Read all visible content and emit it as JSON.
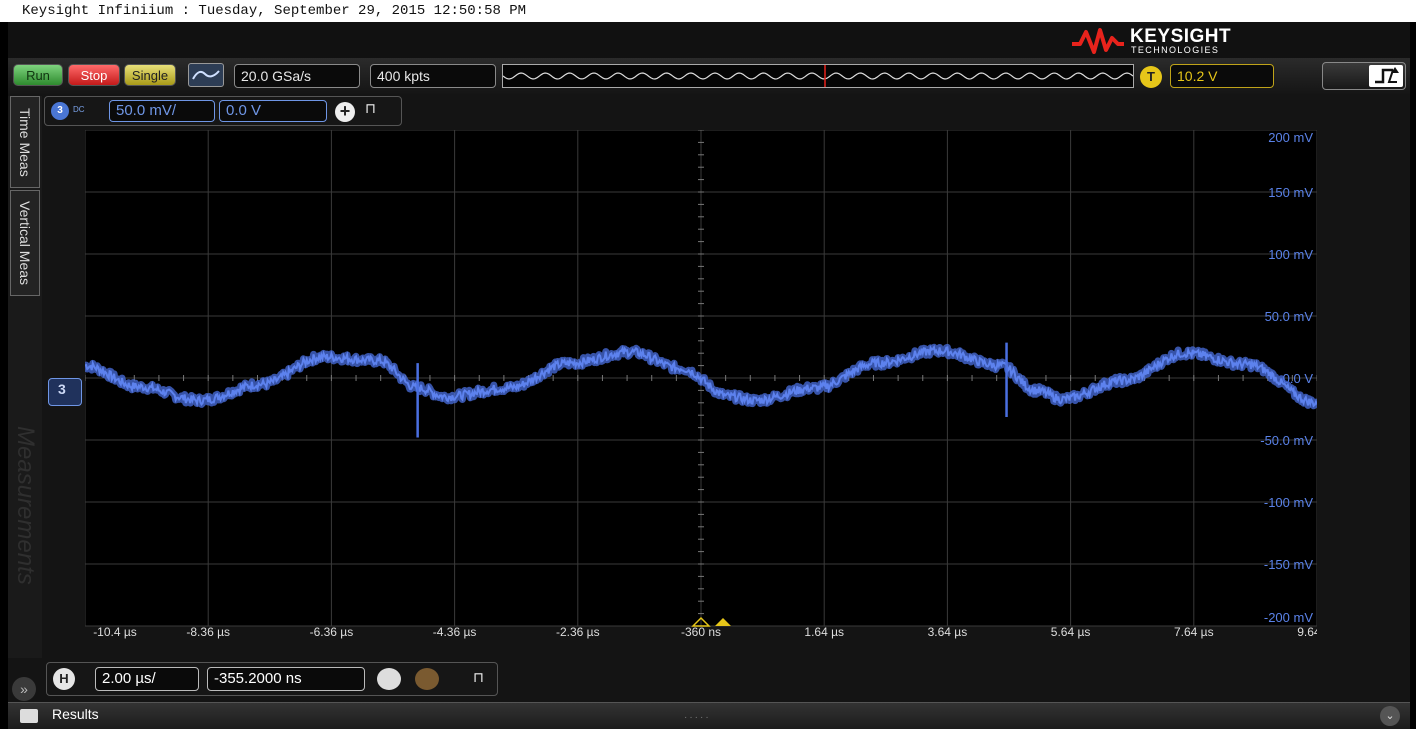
{
  "window": {
    "title": "Keysight Infiniium : Tuesday, September 29, 2015 12:50:58 PM"
  },
  "brand": {
    "name": "KEYSIGHT",
    "subtitle": "TECHNOLOGIES"
  },
  "toolbar": {
    "run_label": "Run",
    "stop_label": "Stop",
    "single_label": "Single",
    "sample_rate": "20.0 GSa/s",
    "memory_depth": "400 kpts",
    "trigger_badge": "T",
    "trigger_level": "10.2 V"
  },
  "channel": {
    "number": "3",
    "coupling": "DC",
    "scale": "50.0 mV/",
    "offset": "0.0 V"
  },
  "sidebar": {
    "tabs": [
      "Time Meas",
      "Vertical Meas"
    ],
    "watermark": "Measurements"
  },
  "horizontal": {
    "badge": "H",
    "scale": "2.00 µs/",
    "position": "-355.2000 ns"
  },
  "results": {
    "label": "Results"
  },
  "colors": {
    "trace": "#4a6fe0",
    "trigger": "#e6c619",
    "grid": "#3a3a3a"
  },
  "chart_data": {
    "type": "line",
    "x_tick_labels": [
      "-10.4 µs",
      "-8.36 µs",
      "-6.36 µs",
      "-4.36 µs",
      "-2.36 µs",
      "-360 ns",
      "1.64 µs",
      "3.64 µs",
      "5.64 µs",
      "7.64 µs",
      "9.64 µs"
    ],
    "y_tick_labels": [
      "200 mV",
      "150 mV",
      "100 mV",
      "50.0 mV",
      "0.0 V",
      "-50.0 mV",
      "-100 mV",
      "-150 mV",
      "-200 mV"
    ],
    "x_unit": "µs",
    "xlim": [
      -10.36,
      9.64
    ],
    "y_unit": "mV",
    "ylim": [
      -200,
      200
    ],
    "grid": true,
    "series": [
      {
        "x": [
          -10.36,
          -9.5,
          -8.5,
          -7.5,
          -6.5,
          -5.6,
          -4.96,
          -4.5,
          -3.5,
          -2.5,
          -1.5,
          -0.7,
          0.12,
          0.5,
          1.5,
          2.5,
          3.5,
          4.5,
          5.08,
          5.5,
          6.5,
          7.5,
          8.5,
          9.64
        ],
        "y": [
          10,
          -7,
          -18,
          -5,
          17,
          14,
          -8,
          -15,
          -8,
          12,
          21,
          8,
          -15,
          -18,
          -8,
          12,
          22,
          10,
          -10,
          -17,
          -2,
          20,
          11,
          -20
        ]
      }
    ],
    "spikes_x": [
      -4.96,
      4.6
    ],
    "spike_amplitude": [
      25,
      -40
    ],
    "trigger_x": -0.36
  }
}
